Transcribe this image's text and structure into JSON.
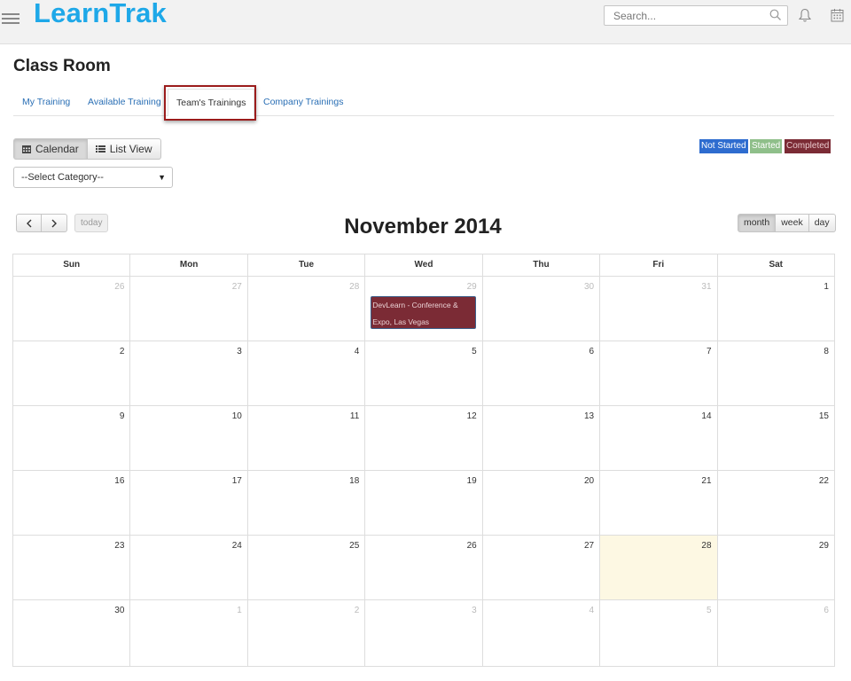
{
  "app": {
    "brand": "LearnTrak"
  },
  "header": {
    "search_placeholder": "Search..."
  },
  "page": {
    "title": "Class Room"
  },
  "tabs": [
    {
      "label": "My Training"
    },
    {
      "label": "Available Training"
    },
    {
      "label": "Team's Trainings"
    },
    {
      "label": "Company Trainings"
    }
  ],
  "view_toggle": {
    "calendar": "Calendar",
    "list": "List View"
  },
  "category_select": {
    "selected": "--Select Category--"
  },
  "legend": [
    {
      "label": "Not Started",
      "color": "#2e6ccf"
    },
    {
      "label": "Started",
      "color": "#8fbf8a"
    },
    {
      "label": "Completed",
      "color": "#7b2b35"
    }
  ],
  "calendar": {
    "title": "November 2014",
    "prev": "<",
    "next": ">",
    "today": "today",
    "views": {
      "month": "month",
      "week": "week",
      "day": "day"
    },
    "days_of_week": [
      "Sun",
      "Mon",
      "Tue",
      "Wed",
      "Thu",
      "Fri",
      "Sat"
    ],
    "weeks": [
      [
        "26",
        "27",
        "28",
        "29",
        "30",
        "31",
        "1"
      ],
      [
        "2",
        "3",
        "4",
        "5",
        "6",
        "7",
        "8"
      ],
      [
        "9",
        "10",
        "11",
        "12",
        "13",
        "14",
        "15"
      ],
      [
        "16",
        "17",
        "18",
        "19",
        "20",
        "21",
        "22"
      ],
      [
        "23",
        "24",
        "25",
        "26",
        "27",
        "28",
        "29"
      ],
      [
        "30",
        "1",
        "2",
        "3",
        "4",
        "5",
        "6"
      ]
    ],
    "events": [
      {
        "title": "DevLearn - Conference & Expo, Las Vegas",
        "color": "#7b2b35"
      }
    ]
  },
  "colors": {
    "brand": "#1ea8e8",
    "link": "#2a6fb5",
    "today_bg": "#fdf8e3"
  }
}
